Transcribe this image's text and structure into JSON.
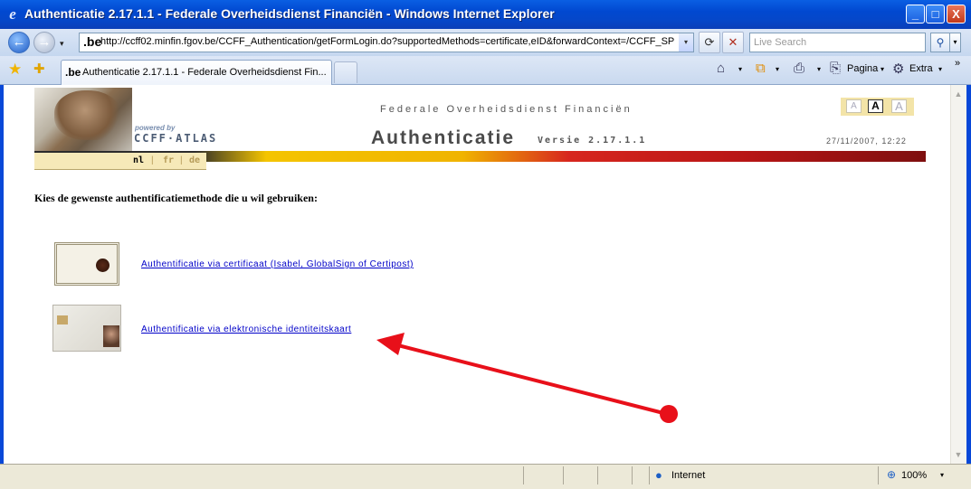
{
  "window": {
    "title": "Authenticatie 2.17.1.1 - Federale Overheidsdienst Financiën - Windows Internet Explorer",
    "ie_icon": "e",
    "minimize": "_",
    "maximize": "□",
    "close": "X"
  },
  "toolbar": {
    "back": "←",
    "forward": "→",
    "history": "▾",
    "site_icon": ".be",
    "url": "http://ccff02.minfin.fgov.be/CCFF_Authentication/getFormLogin.do?supportedMethods=certificate,eID&forwardContext=/CCFF_SP",
    "url_dropdown": "▾",
    "refresh": "⟳",
    "stop": "✕",
    "search_placeholder": "Live Search",
    "search_button": "⚲",
    "search_dropdown": "▾"
  },
  "tabs": {
    "favorites_icon": "★",
    "add_favorites_icon": "✚",
    "tab_icon": ".be",
    "tab_label": "Authenticatie 2.17.1.1 - Federale Overheidsdienst Fin...",
    "home_icon": "⌂",
    "home_dd": "▾",
    "feeds_icon": "⧉",
    "feeds_dd": "▾",
    "print_icon": "⎙",
    "print_dd": "▾",
    "page_icon": "⎘",
    "page_label": "Pagina",
    "page_dd": "▾",
    "tools_icon": "⚙",
    "tools_label": "Extra",
    "tools_dd": "▾",
    "chevron": "»"
  },
  "header": {
    "powered_by": "powered by",
    "brand": "CCFF·ATLAS",
    "org": "Federale Overheidsdienst Financiën",
    "title": "Authenticatie",
    "version": "Versie 2.17.1.1",
    "datetime": "27/11/2007, 12:22",
    "font_sizes": [
      "A",
      "A",
      "A"
    ],
    "languages": [
      "nl",
      "fr",
      "de"
    ],
    "separator": "|"
  },
  "main": {
    "instruction": "Kies de gewenste authentificatiemethode die u wil gebruiken:",
    "options": [
      {
        "label": "Authentificatie via certificaat (Isabel, GlobalSign of Certipost)"
      },
      {
        "label": "Authentificatie via elektronische identiteitskaart"
      }
    ]
  },
  "scrollbar": {
    "up": "▲",
    "down": "▼"
  },
  "statusbar": {
    "globe_icon": "●",
    "zone": "Internet",
    "zoom_icon": "⊕",
    "zoom": "100%",
    "zoom_dd": "▾"
  },
  "annotation": {
    "arrow_color": "#e8101a"
  }
}
